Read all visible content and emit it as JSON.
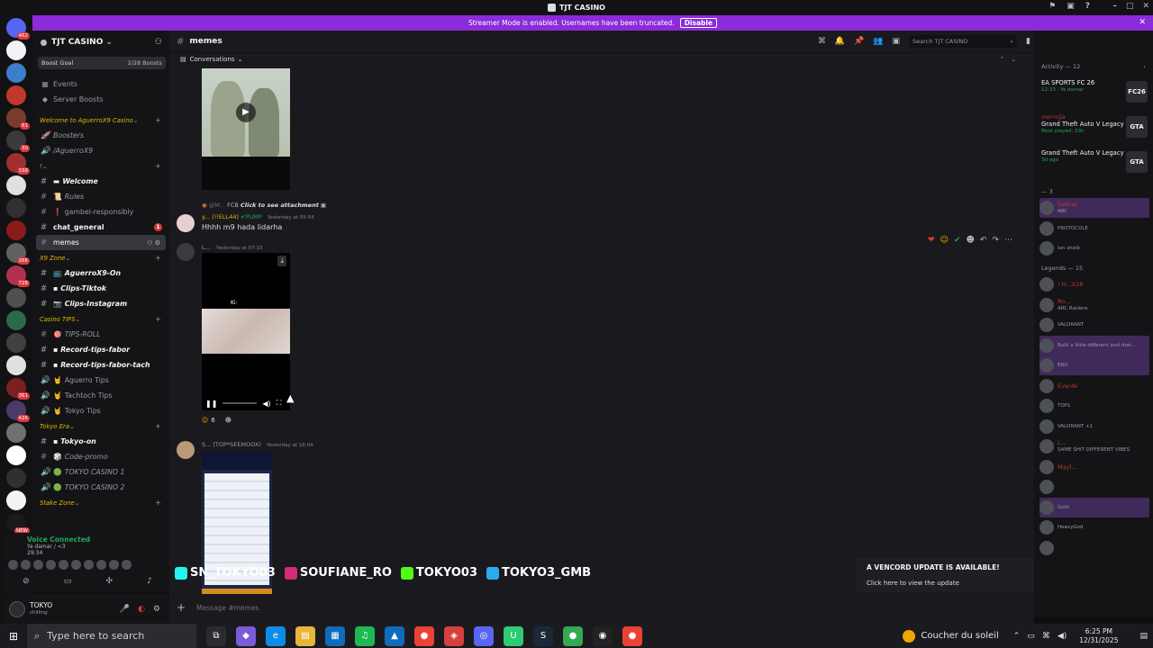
{
  "titlebar": {
    "title": "TJT CASINO"
  },
  "rail": {
    "servers": [
      {
        "badge": "462",
        "color": "#5865f2"
      },
      {
        "badge": "",
        "color": "#f2f3f5"
      },
      {
        "badge": "",
        "color": "#3c7ec9"
      },
      {
        "badge": "",
        "color": "#c0392b"
      },
      {
        "badge": "61",
        "color": "#7a3b2e"
      },
      {
        "badge": "30",
        "color": "#3a3a3a"
      },
      {
        "badge": "338",
        "color": "#a03030"
      },
      {
        "badge": "",
        "color": "#e0e0e0"
      },
      {
        "badge": "",
        "color": "#303030"
      },
      {
        "badge": "",
        "color": "#8b1a1a"
      },
      {
        "badge": "266",
        "color": "#606060"
      },
      {
        "badge": "728",
        "color": "#b03050"
      },
      {
        "badge": "",
        "color": "#505050"
      },
      {
        "badge": "",
        "color": "#2a6a4a"
      },
      {
        "badge": "",
        "color": "#404040"
      },
      {
        "badge": "",
        "color": "#e0e0e0"
      },
      {
        "badge": "361",
        "color": "#7a2020"
      },
      {
        "badge": "426",
        "color": "#4a3a6a"
      },
      {
        "badge": "",
        "color": "#707070"
      },
      {
        "badge": "",
        "color": "#ffffff"
      },
      {
        "badge": "",
        "color": "#303030"
      },
      {
        "badge": "",
        "color": "#f2f3f5"
      },
      {
        "badge": "NEW",
        "color": "#1a1a1a"
      }
    ]
  },
  "banner": {
    "text": "Streamer Mode is enabled. Usernames have been truncated.",
    "button": "Disable"
  },
  "sidebar": {
    "server_name": "TJT CASINO",
    "boost_goal": "Boost Goal",
    "boost_count": "2/28 Boosts",
    "top_items": [
      "Events",
      "Server Boosts"
    ],
    "categories": [
      {
        "name": "Welcome to AguerroX9 Casino",
        "channels": [
          {
            "name": "Boosters",
            "icon": "🚀",
            "style": "em"
          },
          {
            "name": "/AguerroX9",
            "icon": "🔊",
            "style": "em"
          }
        ]
      },
      {
        "name": "!",
        "channels": [
          {
            "name": "Welcome",
            "icon": "#",
            "style": "em bold",
            "emoji": "▬"
          },
          {
            "name": "Rules",
            "icon": "#",
            "style": "em",
            "emoji": "📜"
          },
          {
            "name": "gambel-responsibly",
            "icon": "#",
            "style": "",
            "emoji": "❗"
          },
          {
            "name": "chat_general",
            "icon": "#",
            "style": "bold",
            "emoji": "",
            "mention": "1"
          },
          {
            "name": "memes",
            "icon": "#",
            "style": "active",
            "emoji": ""
          }
        ]
      },
      {
        "name": "X9 Zone",
        "channels": [
          {
            "name": "AguerroX9-On",
            "icon": "#",
            "style": "em bold",
            "emoji": "📺"
          },
          {
            "name": "Clips-Tiktok",
            "icon": "#",
            "style": "em bold",
            "emoji": "▪"
          },
          {
            "name": "Clips-Instagram",
            "icon": "#",
            "style": "em bold",
            "emoji": "📷"
          }
        ]
      },
      {
        "name": "Casino TIPS",
        "channels": [
          {
            "name": "TIPS-ROLL",
            "icon": "#",
            "style": "em",
            "emoji": "🎯"
          },
          {
            "name": "Record-tips-fabor",
            "icon": "#",
            "style": "em bold",
            "emoji": "▪"
          },
          {
            "name": "Record-tips-fabor-tach",
            "icon": "#",
            "style": "em bold",
            "emoji": "▪"
          },
          {
            "name": "Aguerro Tips",
            "icon": "🔊",
            "style": "",
            "emoji": "🤘"
          },
          {
            "name": "Tachtoch Tips",
            "icon": "🔊",
            "style": "",
            "emoji": "🤘"
          },
          {
            "name": "Tokyo Tips",
            "icon": "🔊",
            "style": "",
            "emoji": "🤘"
          }
        ]
      },
      {
        "name": "Tokyo Era",
        "channels": [
          {
            "name": "Tokyo-on",
            "icon": "#",
            "style": "em bold",
            "emoji": "▪"
          },
          {
            "name": "Code-promo",
            "icon": "#",
            "style": "em",
            "emoji": "🎲"
          },
          {
            "name": "TOKYO CASINO 1",
            "icon": "🔊",
            "style": "em",
            "emoji": "🟢"
          },
          {
            "name": "TOKYO CASINO 2",
            "icon": "🔊",
            "style": "em",
            "emoji": "🟢"
          }
        ]
      },
      {
        "name": "Stake Zone",
        "channels": []
      }
    ]
  },
  "voice": {
    "status": "Voice Connected",
    "sub": "Ya damar / <3",
    "time": "29:34"
  },
  "user": {
    "name": "TOKYO",
    "status": "chilling"
  },
  "channel": {
    "name": "memes",
    "search_placeholder": "Search TJT CASINO",
    "conversations": "Conversations",
    "composer_placeholder": "Message #memes"
  },
  "messages": [
    {
      "reply": "Click to see attachment",
      "reply_tag": "FCB",
      "author": "y... (!!ELL44)",
      "tag": "PUMP",
      "time": "Yesterday at 05:54",
      "text": "Hhhh m9 hada lidarha"
    },
    {
      "author": "L...",
      "time": "Yesterday at 07:33",
      "video_label": "Ki:",
      "reaction_count": "6"
    },
    {
      "author": "S... (TOP*SEEMOOX)",
      "time": "Yesterday at 18:04"
    }
  ],
  "socials": [
    {
      "label": "SN_TOKYO03",
      "color": "#25f4ee"
    },
    {
      "label": "SOUFIANE_RO",
      "color": "#d62976"
    },
    {
      "label": "TOKYO03",
      "color": "#53fc18"
    },
    {
      "label": "TOKYO3_GMB",
      "color": "#2aabee"
    }
  ],
  "toast": {
    "title": "A VENCORD UPDATE IS AVAILABLE!",
    "body": "Click here to view the update"
  },
  "activity": {
    "header": "Activity — 12",
    "items": [
      {
        "user": "",
        "game": "EA SPORTS FC 26",
        "detail": "12:33 · Ya damar",
        "icon": "FC26"
      },
      {
        "user": "mer•nija",
        "game": "Grand Theft Auto V Legacy",
        "detail": "Most played: 33h",
        "icon": "GTA"
      },
      {
        "user": "",
        "game": "Grand Theft Auto V Legacy",
        "detail": "3d ago",
        "icon": "GTA"
      }
    ]
  },
  "members": {
    "group1": "— 3",
    "group1_members": [
      {
        "name": "Sakkat",
        "status": "ARC",
        "highlight": true
      },
      {
        "name": "",
        "status": "PROTOCOLE",
        "highlight": false
      },
      {
        "name": "",
        "status": "Ian shelb",
        "highlight": false
      }
    ],
    "group2": "Legends — 15",
    "group2_members": [
      {
        "name": "! H...X18",
        "status": "",
        "highlight": false
      },
      {
        "name": "Ro...",
        "status": "ARC Raiders",
        "highlight": false
      },
      {
        "name": "",
        "status": "VALORANT",
        "highlight": false
      },
      {
        "name": "",
        "status": "Built a little different and that...",
        "highlight": true
      },
      {
        "name": "",
        "status": "ERO",
        "highlight": true
      },
      {
        "name": "Ever4k",
        "status": "",
        "highlight": false
      },
      {
        "name": "",
        "status": "TOP1",
        "highlight": false
      },
      {
        "name": "",
        "status": "VALORANT +1",
        "highlight": false
      },
      {
        "name": "L...",
        "status": "SAME SHIT DIFFERENT VIBES",
        "highlight": false
      },
      {
        "name": "Mayl...",
        "status": "",
        "highlight": false
      },
      {
        "name": "",
        "status": "",
        "highlight": false
      },
      {
        "name": "",
        "status": "Goth",
        "highlight": true
      },
      {
        "name": "",
        "status": "HeavyGod",
        "highlight": false
      },
      {
        "name": "",
        "status": "",
        "highlight": false
      }
    ]
  },
  "taskbar": {
    "search_placeholder": "Type here to search",
    "weather": "Coucher du soleil",
    "time": "6:25 PM",
    "date": "12/31/2025",
    "apps": [
      {
        "icon": "⧉",
        "color": "#2b2b30"
      },
      {
        "icon": "◆",
        "color": "#7b5cd6"
      },
      {
        "icon": "e",
        "color": "#0c8ce9"
      },
      {
        "icon": "▤",
        "color": "#e8b43a"
      },
      {
        "icon": "▦",
        "color": "#0f6cbd"
      },
      {
        "icon": "♫",
        "color": "#1db954"
      },
      {
        "icon": "▲",
        "color": "#0f6cbd"
      },
      {
        "icon": "●",
        "color": "#ea4335"
      },
      {
        "icon": "◈",
        "color": "#d6403f"
      },
      {
        "icon": "◎",
        "color": "#5865f2"
      },
      {
        "icon": "U",
        "color": "#2ecc71"
      },
      {
        "icon": "S",
        "color": "#1b2838"
      },
      {
        "icon": "●",
        "color": "#34a853"
      },
      {
        "icon": "◉",
        "color": "#222"
      },
      {
        "icon": "●",
        "color": "#ea4335"
      }
    ]
  }
}
